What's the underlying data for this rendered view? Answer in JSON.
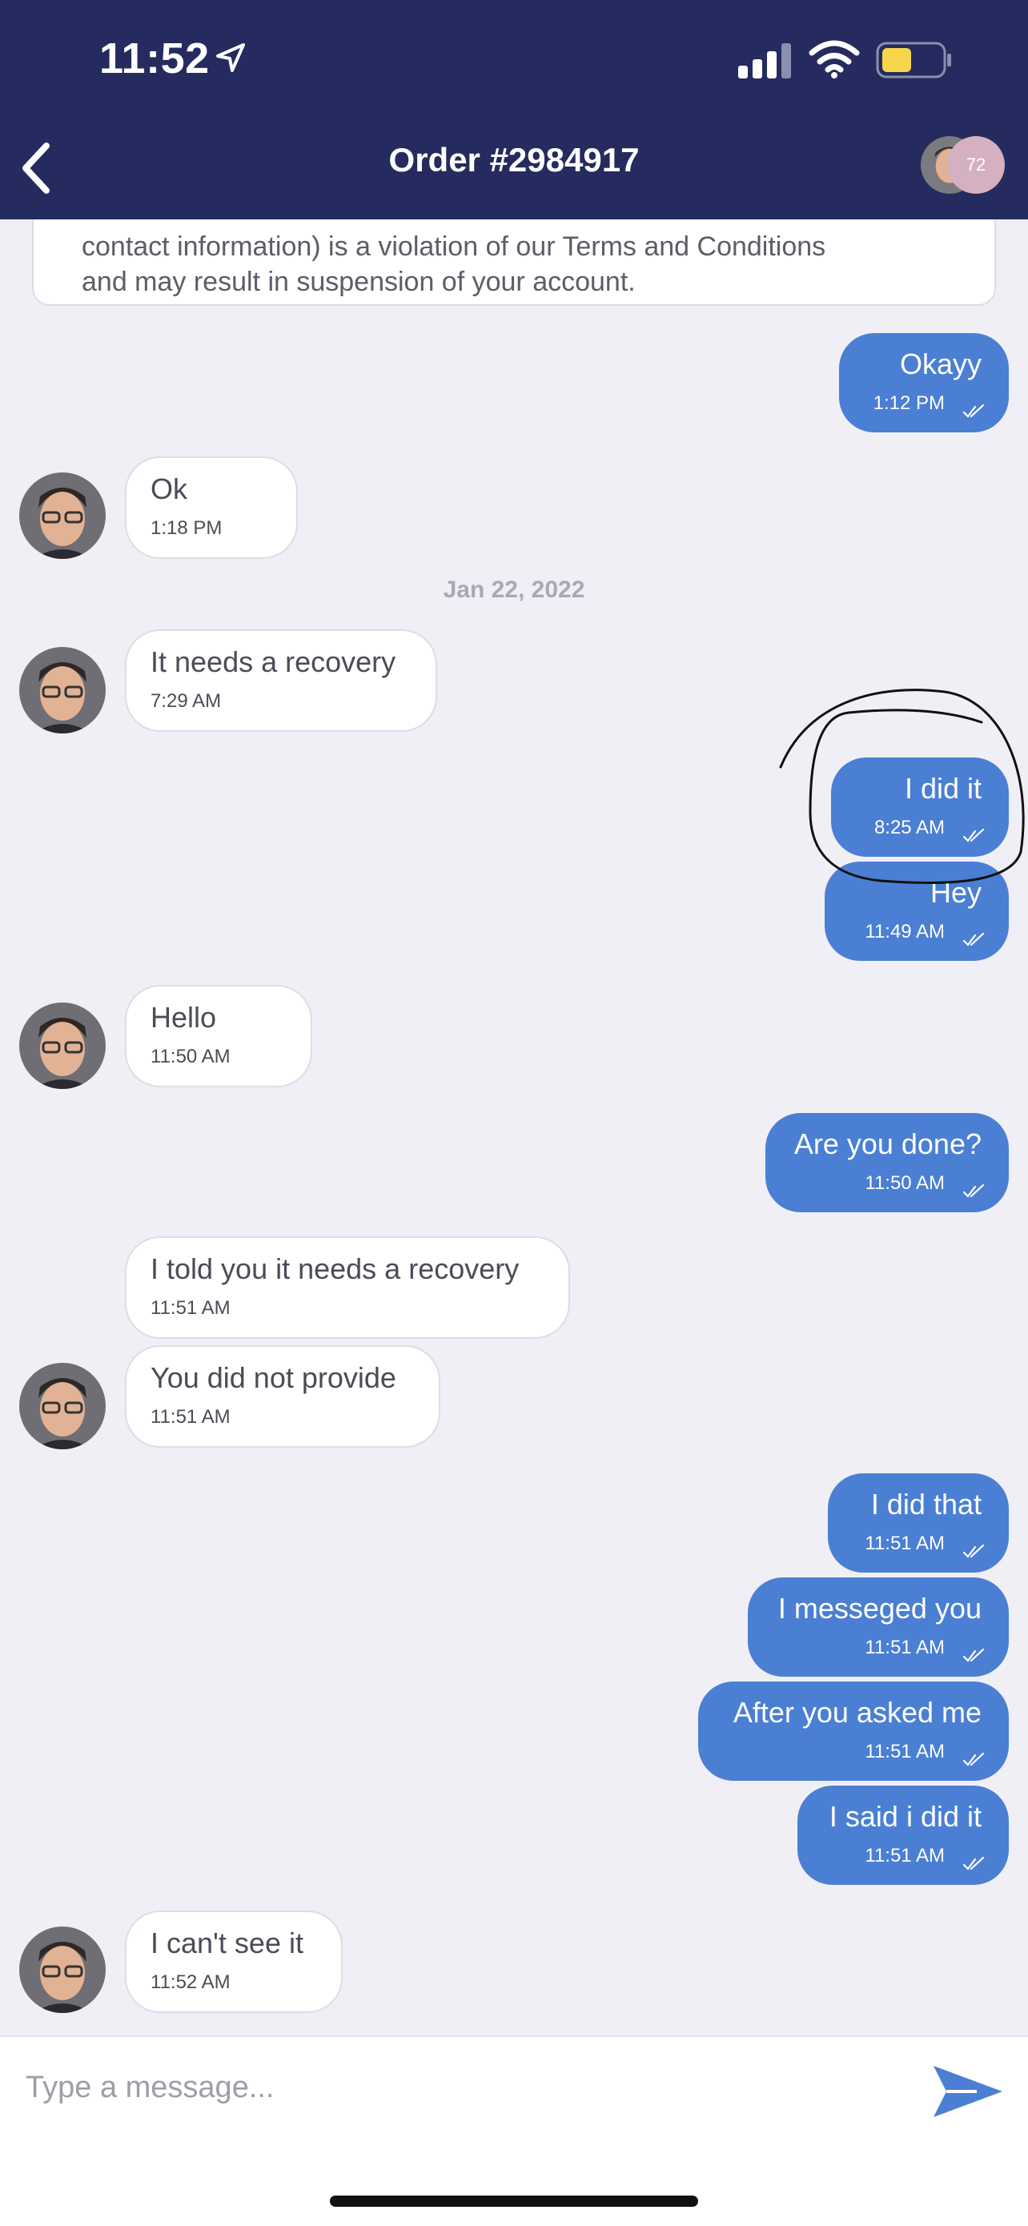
{
  "status_bar": {
    "time": "11:52"
  },
  "header": {
    "title": "Order #2984917",
    "badge": "72"
  },
  "notice": {
    "lines": [
      "contact information) is a violation of our Terms and Conditions",
      "and may result in suspension of your account."
    ]
  },
  "messages": [
    {
      "text": "Okayy",
      "time": "1:12 PM"
    },
    {
      "text": "Ok",
      "time": "1:18 PM"
    },
    {
      "text": "It needs a recovery",
      "time": "7:29 AM"
    },
    {
      "text": "I did it",
      "time": "8:25 AM"
    },
    {
      "text": "Hey",
      "time": "11:49 AM"
    },
    {
      "text": "Hello",
      "time": "11:50 AM"
    },
    {
      "text": "Are you done?",
      "time": "11:50 AM"
    },
    {
      "text": "I told you it needs a recovery",
      "time": "11:51 AM"
    },
    {
      "text": "You did not provide",
      "time": "11:51 AM"
    },
    {
      "text": "I did that",
      "time": "11:51 AM"
    },
    {
      "text": "I messeged you",
      "time": "11:51 AM"
    },
    {
      "text": "After you asked me",
      "time": "11:51 AM"
    },
    {
      "text": "I said i did it",
      "time": "11:51 AM"
    },
    {
      "text": "I can't see it",
      "time": "11:52 AM"
    }
  ],
  "date_separator": "Jan 22, 2022",
  "composer": {
    "placeholder": "Type a message..."
  },
  "colors": {
    "header_bg": "#252b5e",
    "outgoing_bubble": "#4a7fd3",
    "incoming_bubble": "#ffffff",
    "battery_fill": "#f5d64a"
  }
}
